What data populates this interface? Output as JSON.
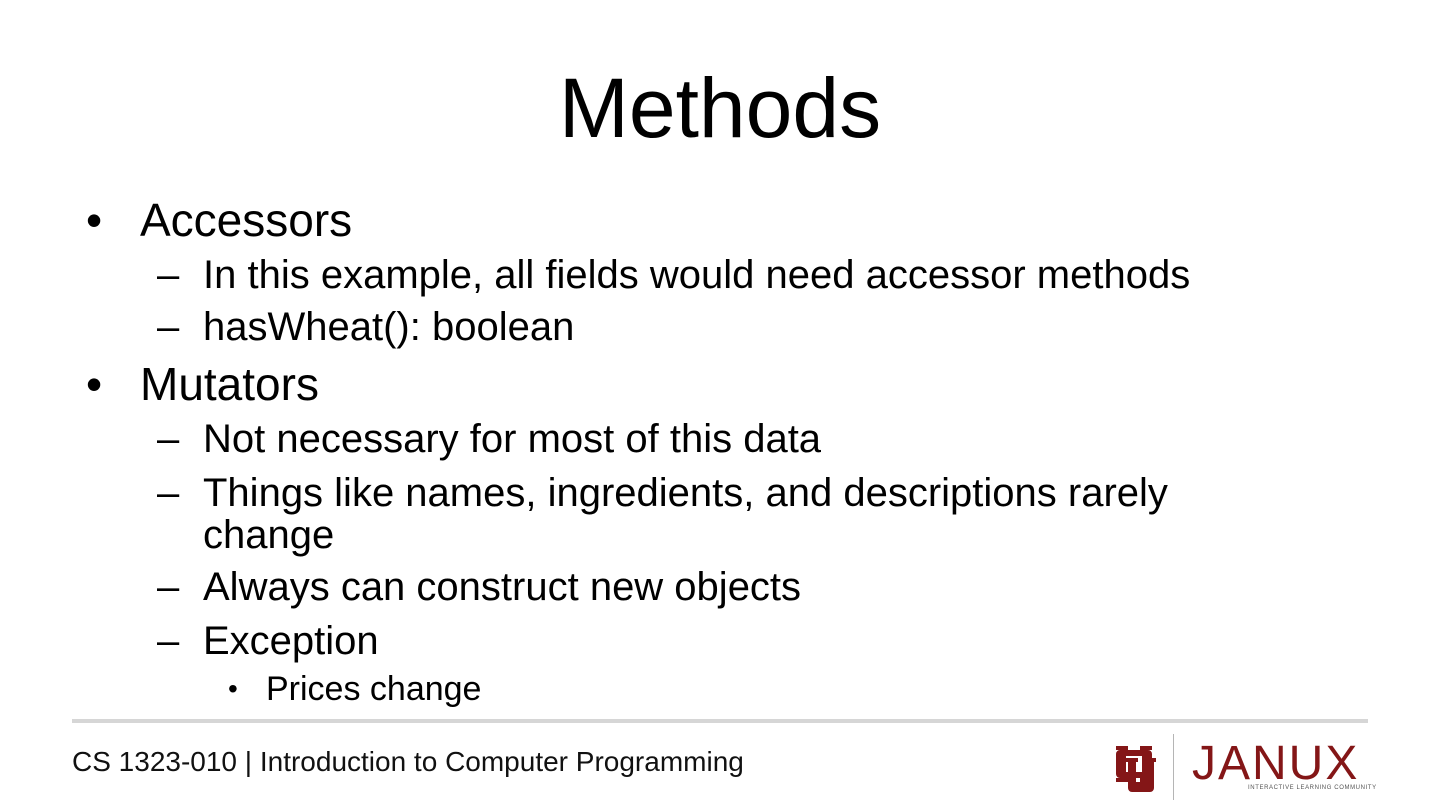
{
  "slide": {
    "title": "Methods"
  },
  "bullets": {
    "accessors": {
      "marker": "•",
      "label": "Accessors",
      "items": [
        {
          "marker": "–",
          "text": "In this example, all fields would need accessor methods"
        },
        {
          "marker": "–",
          "text": "hasWheat(): boolean"
        }
      ]
    },
    "mutators": {
      "marker": "•",
      "label": "Mutators",
      "items": [
        {
          "marker": "–",
          "text": "Not necessary for most of this data"
        },
        {
          "marker": "–",
          "text": "Things like names, ingredients, and descriptions rarely",
          "continuation": "change"
        },
        {
          "marker": "–",
          "text": "Always can construct new objects"
        },
        {
          "marker": "–",
          "text": "Exception"
        }
      ],
      "sub_items": [
        {
          "marker": "•",
          "text": "Prices change"
        }
      ]
    }
  },
  "footer": {
    "course_text": "CS 1323-010 | Introduction to Computer Programming",
    "logo": {
      "brand": "JANUX",
      "tagline": "INTERACTIVE LEARNING COMMUNITY",
      "emblem_icon": "ou-monogram-icon",
      "brand_color": "#841617"
    }
  }
}
